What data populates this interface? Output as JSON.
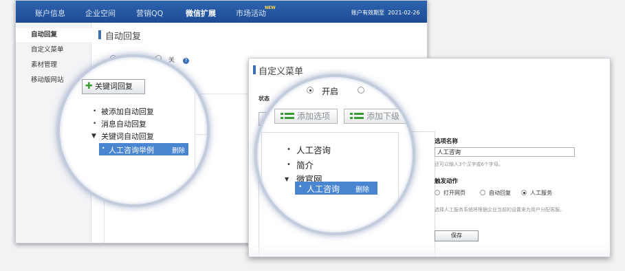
{
  "back_window": {
    "nav": {
      "items": [
        "账户信息",
        "企业空间",
        "营销QQ",
        "微信扩展",
        "市场活动"
      ],
      "active_index": 3,
      "new_badge": "NEW",
      "expiry_label": "账户有效期至",
      "expiry_date": "2021-02-26"
    },
    "sidebar": {
      "items": [
        "自动回复",
        "自定义菜单",
        "素材管理",
        "移动版网站"
      ],
      "active_index": 0
    },
    "page_title": "自动回复",
    "status": {
      "on_label": "开启",
      "off_label_partial": "关",
      "help": "?"
    },
    "zoom": {
      "keyword_button": "关键词回复",
      "tree_items": [
        "被添加自动回复",
        "消息自动回复",
        "关键词自动回复"
      ],
      "selected_item": "人工咨询举例",
      "delete_label": "删除"
    }
  },
  "front_window": {
    "page_title": "自定义菜单",
    "status_label": "状态",
    "status_on": "开启",
    "buttons": {
      "add_option": "添加选项",
      "add_sub": "添加下级"
    },
    "tree": {
      "items": [
        "人工咨询",
        "简介",
        "微官网"
      ],
      "selected_item": "人工咨询",
      "delete_label": "删除"
    },
    "form": {
      "option_name_label": "选项名称",
      "option_name_value": "人工咨询",
      "option_name_hint": "还可以输入3个汉字或6个字母。",
      "trigger_label": "触发动作",
      "trigger_options": [
        "打开网页",
        "自动回复",
        "人工服务"
      ],
      "trigger_selected": 2,
      "trigger_desc": "选择人工服务系统将根据企业当前的设置来为用户分配客服。",
      "save_button": "保存"
    }
  },
  "colors": {
    "nav_bg": "#1c4c95",
    "accent": "#3c6fb6",
    "selection": "#4a85d2",
    "magnifier_ring": "#c3ccdd",
    "plus_green": "#3a9a34",
    "list_icon_green": "#3a9a34"
  }
}
